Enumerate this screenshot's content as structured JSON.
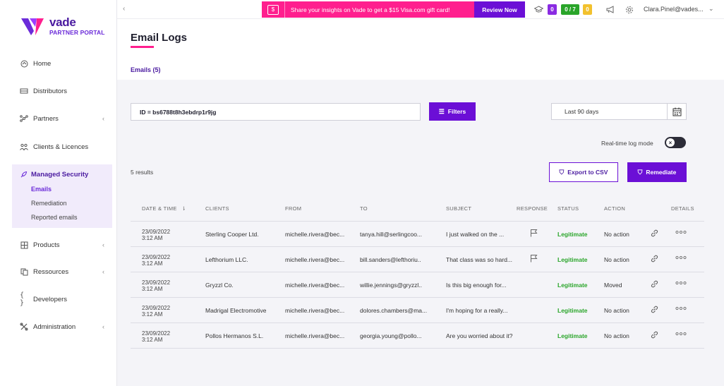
{
  "logo": {
    "brand": "vade",
    "sub": "PARTNER PORTAL"
  },
  "sidebar": {
    "items": [
      {
        "label": "Home",
        "icon": "home-icon"
      },
      {
        "label": "Distributors",
        "icon": "distributors-icon"
      },
      {
        "label": "Partners",
        "icon": "partners-icon"
      },
      {
        "label": "Clients & Licences",
        "icon": "clients-icon"
      },
      {
        "label": "Products",
        "icon": "products-icon"
      },
      {
        "label": "Ressources",
        "icon": "ressources-icon"
      },
      {
        "label": "Developers",
        "icon": "developers-icon"
      },
      {
        "label": "Administration",
        "icon": "administration-icon"
      }
    ],
    "group": {
      "title": "Managed Security",
      "subs": [
        "Emails",
        "Remediation",
        "Reported emails"
      ]
    }
  },
  "topbar": {
    "banner_text": "Share your insights on Vade to get a $15 Visa.com gift card!",
    "banner_button": "Review Now",
    "badge1": "0",
    "badge2": "0 / 7",
    "badge3": "0",
    "user": "Clara.Pinel@vades..."
  },
  "page": {
    "title": "Email Logs",
    "tab": "Emails (5)",
    "search_value": "ID = bs6788t8h3ebdrp1r9jg",
    "filters_label": "Filters",
    "date_range": "Last 90 days",
    "realtime_label": "Real-time log mode",
    "results": "5 results",
    "export_label": "Export to CSV",
    "remediate_label": "Remediate"
  },
  "table": {
    "headers": [
      "DATE & TIME",
      "CLIENTS",
      "FROM",
      "TO",
      "SUBJECT",
      "RESPONSE",
      "STATUS",
      "ACTION",
      "DETAILS"
    ],
    "rows": [
      {
        "date": "23/09/2022",
        "time": "3:12 AM",
        "client": "Sterling Cooper Ltd.",
        "from": "michelle.rivera@bec...",
        "to": "tanya.hill@serlingcoo...",
        "subject": "I just walked on the ...",
        "response": true,
        "status": "Legitimate",
        "action": "No action"
      },
      {
        "date": "23/09/2022",
        "time": "3:12 AM",
        "client": "Lefthorium LLC.",
        "from": "michelle.rivera@bec...",
        "to": "bill.sanders@lefthoriu..",
        "subject": "That class was so hard...",
        "response": true,
        "status": "Legitimate",
        "action": "No action"
      },
      {
        "date": "23/09/2022",
        "time": "3:12 AM",
        "client": "Gryzzl Co.",
        "from": "michelle.rivera@bec...",
        "to": "willie.jennings@gryzzl..",
        "subject": "Is this big enough for...",
        "response": false,
        "status": "Legitimate",
        "action": "Moved"
      },
      {
        "date": "23/09/2022",
        "time": "3:12 AM",
        "client": "Madrigal Electromotive",
        "from": "michelle.rivera@bec...",
        "to": "dolores.chambers@ma...",
        "subject": "I'm hoping for a really...",
        "response": false,
        "status": "Legitimate",
        "action": "No action"
      },
      {
        "date": "23/09/2022",
        "time": "3:12 AM",
        "client": "Pollos Hermanos S.L.",
        "from": "michelle.rivera@bec...",
        "to": "georgia.young@pollo...",
        "subject": "Are you worried about it?",
        "response": false,
        "status": "Legitimate",
        "action": "No action"
      }
    ]
  },
  "colors": {
    "accent": "#6b0fd6",
    "brand": "#4a1aa0",
    "pink": "#ff1f8e",
    "legit": "#2aa52a"
  }
}
